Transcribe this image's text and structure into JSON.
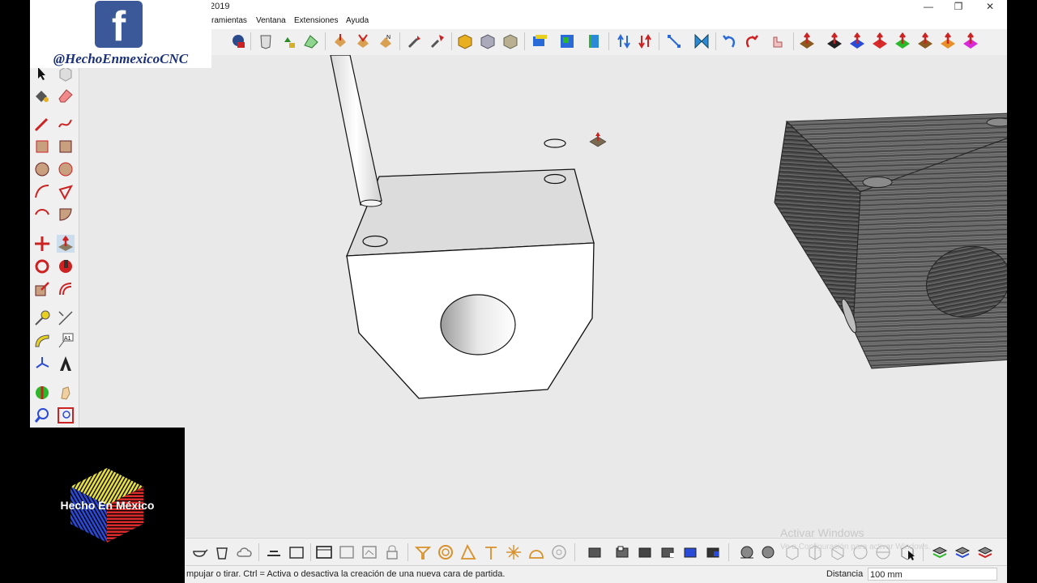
{
  "window": {
    "title_fragment": "2019",
    "minimize_glyph": "—",
    "restore_glyph": "❐",
    "close_glyph": "✕"
  },
  "menu": {
    "items": [
      "ramientas",
      "Ventana",
      "Extensiones",
      "Ayuda"
    ]
  },
  "overlay": {
    "facebook_letter": "f",
    "channel_handle": "@HechoEnmexicoCNC",
    "brand_text": "Hecho En México"
  },
  "status": {
    "message": "mpujar o tirar. Ctrl = Activa o desactiva la creación de una nueva cara de partida.",
    "distance_label": "Distancia",
    "distance_value": "100 mm"
  },
  "watermark": {
    "title": "Activar Windows",
    "subtitle": "Ve a Configuración para activar Windows."
  },
  "icons": {
    "top_toolbar": [
      "component-icon",
      "eraser-3d-icon",
      "paint-icon",
      "sandbox-icon",
      "camera-a-icon",
      "camera-b-icon",
      "camera-c-icon",
      "walk-icon",
      "look-icon",
      "box-yellow-icon",
      "box-gray-icon",
      "box-shaded-icon",
      "view-iso-icon",
      "view-top-icon",
      "view-front-icon",
      "up-arrow-icon",
      "down-arrow-icon",
      "scale-icon",
      "flip-icon",
      "undo-icon",
      "redo-icon",
      "hand-icon",
      "axis-red-icon",
      "axis-black-icon",
      "axis-blue-icon",
      "axis-red2-icon",
      "axis-green-icon",
      "axis-brown-icon",
      "axis-orange-icon",
      "axis-pink-icon"
    ],
    "left_toolbar": [
      "select-icon",
      "component-icon",
      "paint-bucket-icon",
      "eraser-icon",
      "pencil-icon",
      "freehand-icon",
      "rectangle-icon",
      "rotated-rect-icon",
      "circle-icon",
      "polygon-icon",
      "arc-icon",
      "pie-icon",
      "arc3-icon",
      "arc2-icon",
      "move-icon",
      "push-pull-icon",
      "rotate-icon",
      "follow-me-icon",
      "scale-icon",
      "offset-icon",
      "tape-measure-icon",
      "dimension-icon",
      "protractor-icon",
      "text-icon",
      "axes-icon",
      "3d-text-icon",
      "section-plane-icon",
      "walk-icon",
      "zoom-icon",
      "zoom-extents-icon"
    ],
    "bottom_toolbar": [
      "teapot-icon",
      "bucket-icon",
      "cloud-icon",
      "layers-icon",
      "table-icon",
      "window-icon",
      "window2-icon",
      "window3-icon",
      "lock-icon",
      "funnel-icon",
      "circle-icon",
      "triangle-icon",
      "pin-icon",
      "sparkle-icon",
      "shell-icon",
      "gear-icon",
      "cube-a-icon",
      "cube-b-icon",
      "cube-c-icon",
      "cube-d-icon",
      "cube-e-icon",
      "cube-f-icon",
      "sphere-icon",
      "sphere2-icon",
      "wire-a-icon",
      "wire-b-icon",
      "wire-c-icon",
      "wire-d-icon",
      "wire-e-icon",
      "cursor-icon",
      "stack-a-icon",
      "stack-b-icon",
      "stack-c-icon"
    ]
  },
  "colors": {
    "facebook_blue": "#3b5998",
    "handle_navy": "#1a2f7a",
    "viewport_bg": "#e9e9e9"
  }
}
